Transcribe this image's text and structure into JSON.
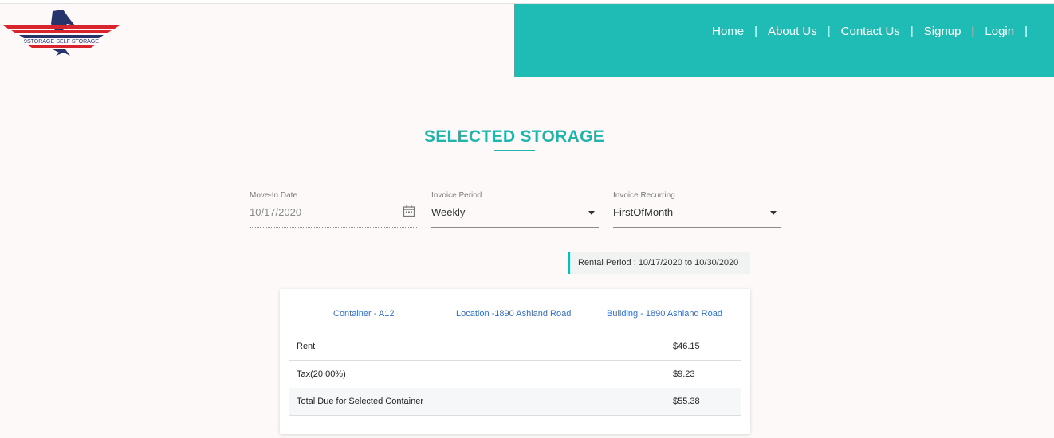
{
  "header": {
    "logo_text": "9STORAGE-SELF STORAGE",
    "nav": [
      "Home",
      "About Us",
      "Contact Us",
      "Signup",
      "Login"
    ],
    "separator": "|"
  },
  "page_title": "SELECTED STORAGE",
  "form": {
    "move_in": {
      "label": "Move-In Date",
      "value": "10/17/2020",
      "icon": "calendar-icon"
    },
    "invoice_period": {
      "label": "Invoice Period",
      "value": "Weekly"
    },
    "invoice_recurring": {
      "label": "Invoice Recurring",
      "value": "FirstOfMonth"
    }
  },
  "rental_period": "Rental Period : 10/17/2020  to 10/30/2020",
  "card": {
    "container": "Container - A12",
    "location": "Location -1890 Ashland Road",
    "building": "Building - 1890 Ashland Road",
    "rows": [
      {
        "label": "Rent",
        "amount": "$46.15"
      },
      {
        "label": "Tax(20.00%)",
        "amount": "$9.23"
      },
      {
        "label": "Total Due for Selected Container",
        "amount": "$55.38"
      }
    ]
  },
  "colors": {
    "accent": "#1fbcb6",
    "link": "#2c6fc9",
    "logo_red": "#d8242c",
    "logo_navy": "#27346c"
  }
}
